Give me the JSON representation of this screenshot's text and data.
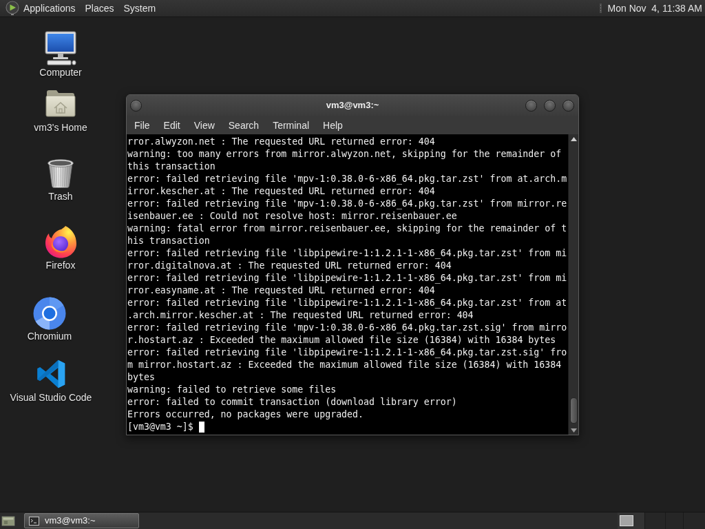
{
  "top_panel": {
    "menus": [
      "Applications",
      "Places",
      "System"
    ],
    "clock": "Mon Nov  4, 11:38 AM"
  },
  "desktop_icons": [
    {
      "label": "Computer",
      "kind": "computer"
    },
    {
      "label": "vm3's Home",
      "kind": "home"
    },
    {
      "label": "Trash",
      "kind": "trash"
    },
    {
      "label": "Firefox",
      "kind": "firefox"
    },
    {
      "label": "Chromium",
      "kind": "chromium"
    },
    {
      "label": "Visual Studio Code",
      "kind": "vscode"
    }
  ],
  "terminal_window": {
    "title": "vm3@vm3:~",
    "menu": [
      "File",
      "Edit",
      "View",
      "Search",
      "Terminal",
      "Help"
    ],
    "lines": [
      "rror.alwyzon.net : The requested URL returned error: 404",
      "warning: too many errors from mirror.alwyzon.net, skipping for the remainder of",
      "this transaction",
      "error: failed retrieving file 'mpv-1:0.38.0-6-x86_64.pkg.tar.zst' from at.arch.m",
      "irror.kescher.at : The requested URL returned error: 404",
      "error: failed retrieving file 'mpv-1:0.38.0-6-x86_64.pkg.tar.zst' from mirror.re",
      "isenbauer.ee : Could not resolve host: mirror.reisenbauer.ee",
      "warning: fatal error from mirror.reisenbauer.ee, skipping for the remainder of t",
      "his transaction",
      "error: failed retrieving file 'libpipewire-1:1.2.1-1-x86_64.pkg.tar.zst' from mi",
      "rror.digitalnova.at : The requested URL returned error: 404",
      "error: failed retrieving file 'libpipewire-1:1.2.1-1-x86_64.pkg.tar.zst' from mi",
      "rror.easyname.at : The requested URL returned error: 404",
      "error: failed retrieving file 'libpipewire-1:1.2.1-1-x86_64.pkg.tar.zst' from at",
      ".arch.mirror.kescher.at : The requested URL returned error: 404",
      "error: failed retrieving file 'mpv-1:0.38.0-6-x86_64.pkg.tar.zst.sig' from mirro",
      "r.hostart.az : Exceeded the maximum allowed file size (16384) with 16384 bytes",
      "error: failed retrieving file 'libpipewire-1:1.2.1-1-x86_64.pkg.tar.zst.sig' fro",
      "m mirror.hostart.az : Exceeded the maximum allowed file size (16384) with 16384",
      "bytes",
      "warning: failed to retrieve some files",
      "error: failed to commit transaction (download library error)",
      "Errors occurred, no packages were upgraded."
    ],
    "prompt": "[vm3@vm3 ~]$"
  },
  "bottom_panel": {
    "tasks": [
      {
        "label": "vm3@vm3:~",
        "selected": true
      }
    ]
  }
}
